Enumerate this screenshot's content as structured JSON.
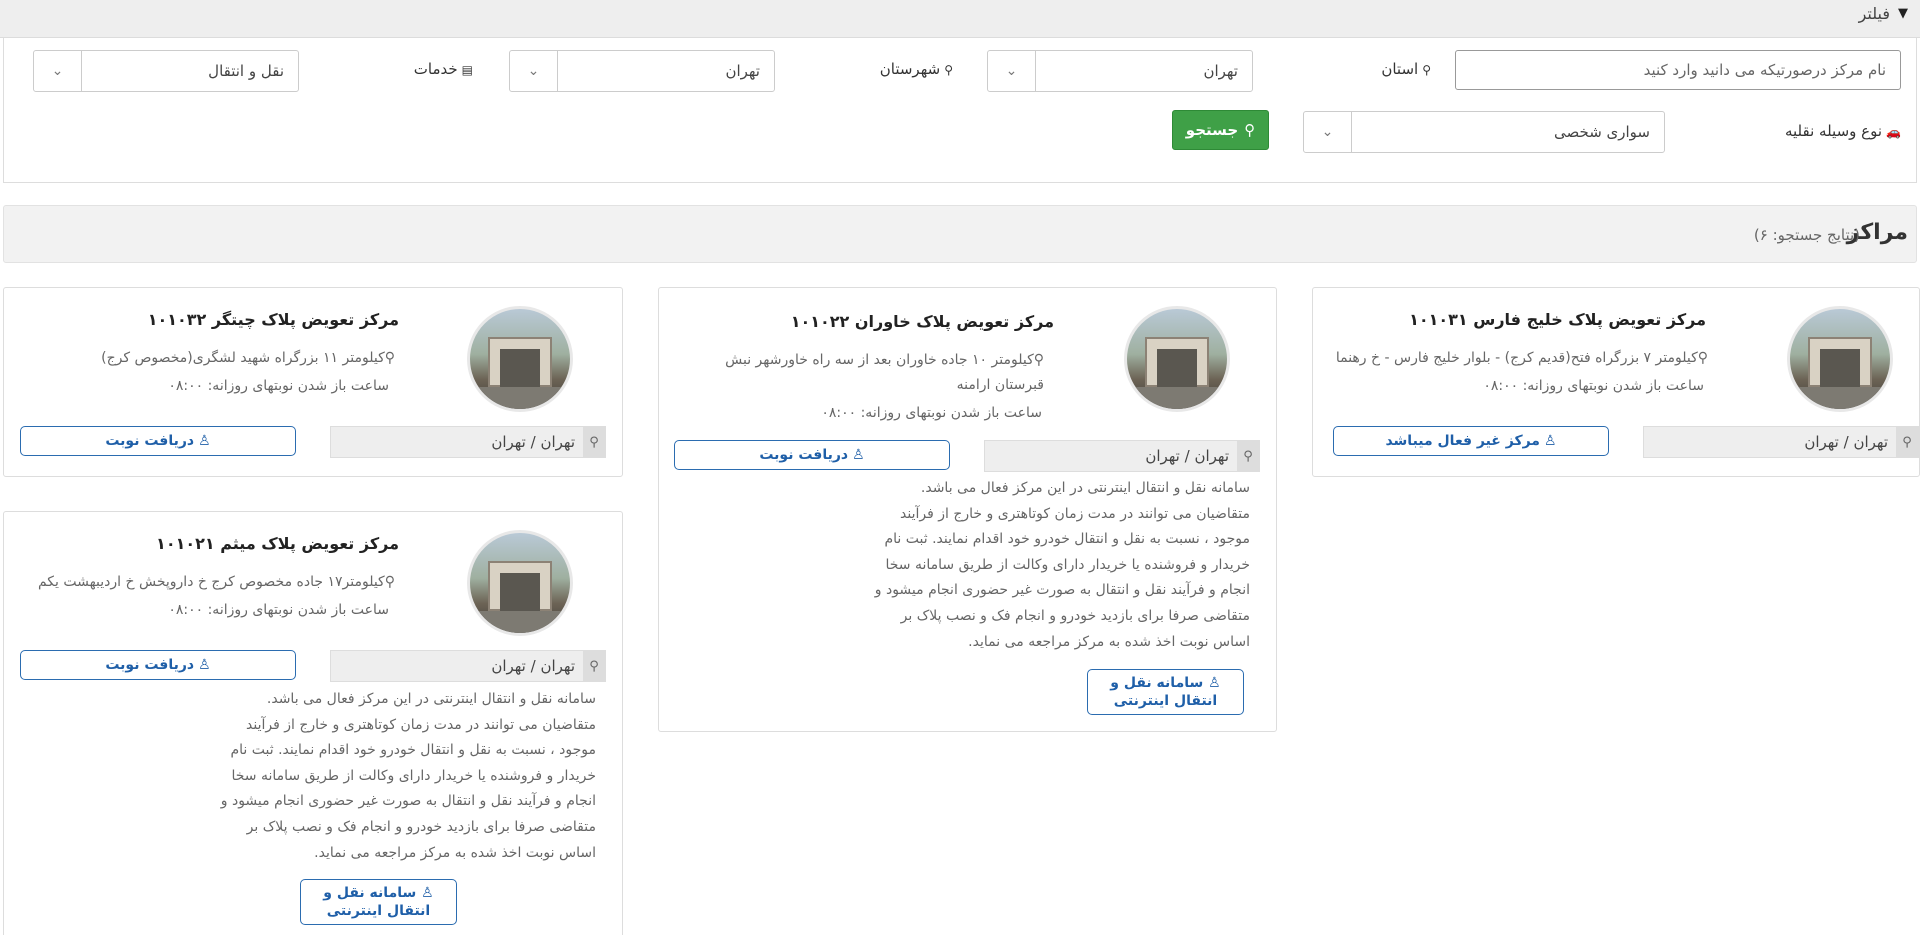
{
  "filter": {
    "title": "فیلتر",
    "center_name_placeholder": "نام مرکز درصورتیکه می دانید وارد کنید",
    "province_label": "استان",
    "province_value": "تهران",
    "city_label": "شهرستان",
    "city_value": "تهران",
    "services_label": "خدمات",
    "services_value": "نقل و انتقال",
    "vehicle_label": "نوع وسیله نقلیه",
    "vehicle_value": "سواری شخصی",
    "search_label": "جستجو"
  },
  "results": {
    "title": "مراکز",
    "count_text": "(نتایج جستجو: ۶)"
  },
  "cards": [
    {
      "title": "مرکز تعویض پلاک خلیج فارس ۱۰۱۰۳۱",
      "address": "کیلومتر ۷ بزرگراه فتح(قدیم کرج) - بلوار خلیج فارس - خ رهنما",
      "hours": "ساعت باز شدن نوبتهای روزانه: ۰۸:۰۰",
      "location": "تهران / تهران",
      "action": "مرکز غیر فعال میباشد"
    },
    {
      "title": "مرکز تعویض پلاک خاوران ۱۰۱۰۲۲",
      "address": "کیلومتر ۱۰ جاده خاوران بعد از سه راه خاورشهر نبش قبرستان ارامنه",
      "hours": "ساعت باز شدن نوبتهای روزانه: ۰۸:۰۰",
      "location": "تهران / تهران",
      "action": "دریافت نوبت",
      "description": "سامانه نقل و انتقال اینترنتی در این مرکز فعال می باشد. متقاضیان می توانند در مدت زمان کوتاهتری و خارج از فرآیند موجود ، نسبت به نقل و انتقال خودرو خود اقدام نمایند. ثبت نام خریدار و فروشنده یا خریدار دارای وکالت از طریق سامانه سخا انجام و فرآیند نقل و انتقال به صورت غیر حضوری انجام میشود و متقاضی صرفا برای بازدید خودرو و انجام فک و نصب پلاک بر اساس نوبت اخذ شده به مرکز مراجعه می نماید.",
      "online_button": "سامانه نقل و انتقال اینترنتی"
    },
    {
      "title": "مرکز تعویض پلاک چیتگر ۱۰۱۰۳۲",
      "address": "کیلومتر ۱۱ بزرگراه شهید لشگری(مخصوص کرج)",
      "hours": "ساعت باز شدن نوبتهای روزانه: ۰۸:۰۰",
      "location": "تهران / تهران",
      "action": "دریافت نوبت"
    },
    {
      "title": "مرکز تعویض پلاک میثم ۱۰۱۰۲۱",
      "address": "کیلومتر۱۷ جاده مخصوص کرج خ داروپخش خ اردیبهشت یکم",
      "hours": "ساعت باز شدن نوبتهای روزانه: ۰۸:۰۰",
      "location": "تهران / تهران",
      "action": "دریافت نوبت",
      "description": "سامانه نقل و انتقال اینترنتی در این مرکز فعال می باشد. متقاضیان می توانند در مدت زمان کوتاهتری و خارج از فرآیند موجود ، نسبت به نقل و انتقال خودرو خود اقدام نمایند. ثبت نام خریدار و فروشنده یا خریدار دارای وکالت از طریق سامانه سخا انجام و فرآیند نقل و انتقال به صورت غیر حضوری انجام میشود و متقاضی صرفا برای بازدید خودرو و انجام فک و نصب پلاک بر اساس نوبت اخذ شده به مرکز مراجعه می نماید.",
      "online_button": "سامانه نقل و انتقال اینترنتی"
    }
  ],
  "icons": {
    "filter": "funnel-icon",
    "pin": "map-marker-icon",
    "services": "list-icon",
    "car": "car-icon",
    "search": "search-icon",
    "user": "user-icon",
    "dropdown": "chevron-down-icon"
  },
  "colors": {
    "search_button": "#3fa047",
    "action_button_border": "#2b6cb0",
    "action_button_text": "#1f5fa8"
  }
}
